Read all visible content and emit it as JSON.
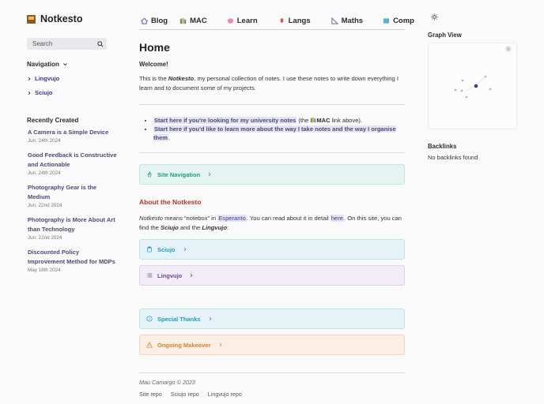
{
  "site": {
    "title": "Notkesto"
  },
  "search": {
    "label": "Search"
  },
  "navigation": {
    "heading": "Navigation",
    "items": [
      {
        "label": "Lingvujo"
      },
      {
        "label": "Sciujo"
      }
    ]
  },
  "recent": {
    "heading": "Recently Created",
    "items": [
      {
        "title": "A Camera is a Simple Device",
        "date": "Jun. 24th 2024"
      },
      {
        "title": "Good Feedback is Constructive and Actionable",
        "date": "Jun. 24th 2024"
      },
      {
        "title": "Photography Gear is the Medium",
        "date": "Jun. 22nd 2024"
      },
      {
        "title": "Photography is More About Art than Technology",
        "date": "Jun. 22nd 2024"
      },
      {
        "title": "Discounted Policy Improvement Method for MDPs",
        "date": "May 18th 2024"
      }
    ]
  },
  "topnav": {
    "items": [
      {
        "label": "Blog",
        "icon": "house-icon",
        "color": "#6a6ab0"
      },
      {
        "label": "MAC",
        "icon": "books-icon",
        "color": "#5a9a5a"
      },
      {
        "label": "Learn",
        "icon": "brain-icon",
        "color": "#e07ab0"
      },
      {
        "label": "Langs",
        "icon": "tongue-icon",
        "color": "#d0604a"
      },
      {
        "label": "Maths",
        "icon": "triangle-ruler-icon",
        "color": "#8a8aa0"
      },
      {
        "label": "Comp",
        "icon": "computer-icon",
        "color": "#4aa0d0"
      }
    ]
  },
  "main": {
    "title": "Home",
    "welcome": "Welcome!",
    "intro": {
      "prefix": "This is the ",
      "name": "Notkesto",
      "suffix": ", my personal collection of notes. I use these notes to write down everything I learn and to document some of my projects."
    },
    "bullet1": {
      "link": "Start here if you're looking for my university notes",
      "pre": " (the ",
      "mac": "MAC",
      "post": " link above)."
    },
    "bullet2": {
      "link": "Start here if you'd like to learn more about the way I take notes and the way I organise them",
      "post": "."
    },
    "callout_nav": "Site Navigation",
    "about_heading": "About the Notkesto",
    "about": {
      "w1": "Notkesto",
      "t1": " means “notebox” in ",
      "link1": "Esperanto",
      "t2": ". You can read about it in detail ",
      "link2": "here",
      "t3": ". On this site, you can find the ",
      "w2": "Sciujo",
      "t4": " and the ",
      "w3": "Lingvujo",
      "t5": ":"
    },
    "callout_sciujo": "Sciujo",
    "callout_lingvujo": "Lingvujo",
    "callout_thanks": "Special Thanks",
    "callout_makeover": "Ongoing Makeover"
  },
  "footer": {
    "credit": "Mau Camargo © 2023",
    "links": [
      {
        "label": "Site repo"
      },
      {
        "label": "Sciujo repo"
      },
      {
        "label": "Lingvujo repo"
      }
    ]
  },
  "right": {
    "graph_heading": "Graph View",
    "backlinks_heading": "Backlinks",
    "backlinks_text": "No backlinks found"
  },
  "colors": {
    "accent": "#3b3a8f",
    "heading_red": "#b5342a"
  }
}
